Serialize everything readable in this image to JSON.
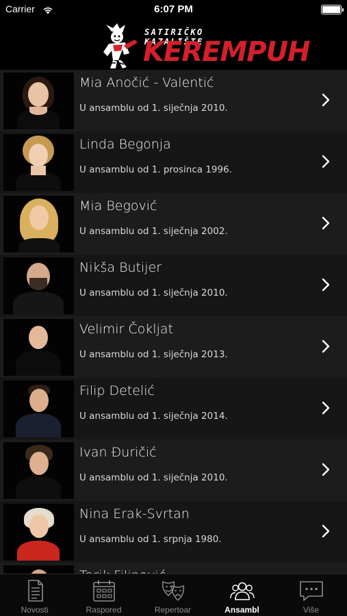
{
  "status_bar": {
    "carrier": "Carrier",
    "time": "6:07 PM"
  },
  "header": {
    "logo_tagline": "SATIRIČKO KAZALIŠTE",
    "logo_wordmark": "KEREMPUH"
  },
  "ensemble": [
    {
      "name": "Mia Anočić - Valentić",
      "since": "U ansamblu od 1. siječnja 2010."
    },
    {
      "name": "Linda Begonja",
      "since": "U ansamblu od 1. prosinca 1996."
    },
    {
      "name": "Mia Begović",
      "since": "U ansamblu od 1. siječnja 2002."
    },
    {
      "name": "Nikša Butijer",
      "since": "U ansamblu od 1. siječnja 2010."
    },
    {
      "name": "Velimir Čokljat",
      "since": "U ansamblu od 1. siječnja 2013."
    },
    {
      "name": "Filip Detelić",
      "since": "U ansamblu od 1. siječnja 2014."
    },
    {
      "name": "Ivan Đuričić",
      "since": "U ansamblu od 1. siječnja 2010."
    },
    {
      "name": "Nina Erak-Svrtan",
      "since": "U ansamblu od 1. srpnja 1980."
    },
    {
      "name": "Tarik Filipović",
      "since": ""
    }
  ],
  "tabs": [
    {
      "label": "Novosti",
      "icon": "news-icon",
      "active": false
    },
    {
      "label": "Raspored",
      "icon": "calendar-icon",
      "active": false
    },
    {
      "label": "Repertoar",
      "icon": "theater-masks-icon",
      "active": false
    },
    {
      "label": "Ansambl",
      "icon": "people-icon",
      "active": true
    },
    {
      "label": "Više",
      "icon": "more-icon",
      "active": false
    }
  ],
  "colors": {
    "accent_red": "#d3202a",
    "background": "#000000",
    "tab_active": "#ffffff",
    "tab_inactive": "#8c8c8c"
  }
}
